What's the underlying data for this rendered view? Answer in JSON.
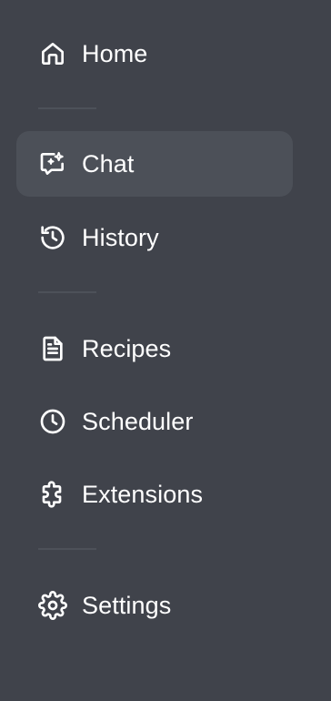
{
  "sidebar": {
    "items": [
      {
        "id": "home",
        "label": "Home",
        "icon": "home-icon",
        "active": false
      },
      {
        "id": "chat",
        "label": "Chat",
        "icon": "chat-sparkle-icon",
        "active": true
      },
      {
        "id": "history",
        "label": "History",
        "icon": "history-icon",
        "active": false
      },
      {
        "id": "recipes",
        "label": "Recipes",
        "icon": "document-icon",
        "active": false
      },
      {
        "id": "scheduler",
        "label": "Scheduler",
        "icon": "clock-icon",
        "active": false
      },
      {
        "id": "extensions",
        "label": "Extensions",
        "icon": "puzzle-icon",
        "active": false
      },
      {
        "id": "settings",
        "label": "Settings",
        "icon": "gear-icon",
        "active": false
      }
    ]
  },
  "colors": {
    "background": "#40434b",
    "active_item": "#4c5058",
    "divider": "#4d5159",
    "text": "#ffffff"
  }
}
